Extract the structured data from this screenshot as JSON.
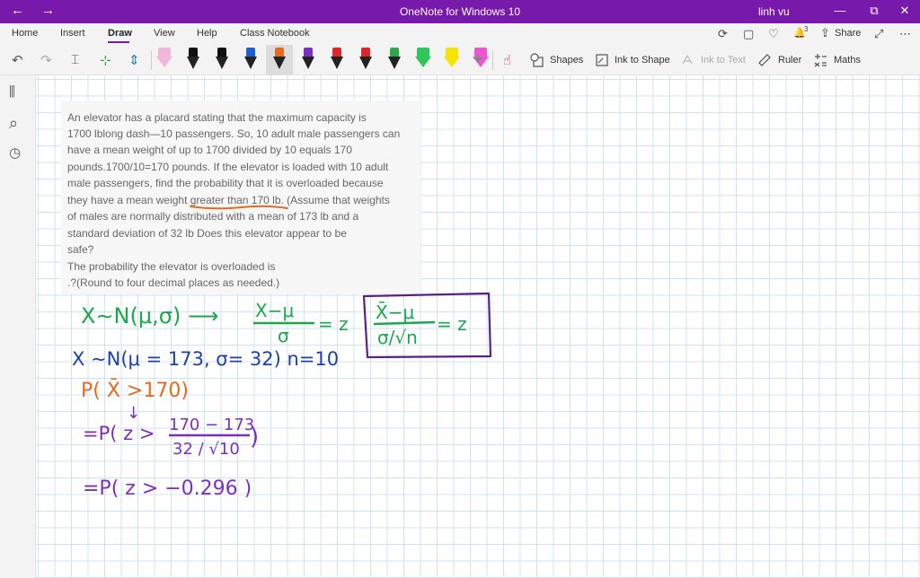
{
  "titlebar": {
    "back": "←",
    "forward": "→",
    "app_title": "OneNote for Windows 10",
    "user": "linh vu",
    "minimize": "—",
    "restore": "⧉",
    "close": "✕"
  },
  "tabs": [
    {
      "label": "Home"
    },
    {
      "label": "Insert"
    },
    {
      "label": "Draw",
      "active": true
    },
    {
      "label": "View"
    },
    {
      "label": "Help"
    },
    {
      "label": "Class Notebook"
    }
  ],
  "tab_actions": {
    "sync": "⟳",
    "notebook": "▢",
    "ideas": "♡",
    "notifications": "🔔",
    "notification_count": "3",
    "share_icon": "⇪",
    "share_label": "Share",
    "expand": "⤢",
    "more": "⋯"
  },
  "toolbar": {
    "undo": "↶",
    "redo": "↷",
    "select_icon": "⌶",
    "lasso_icon": "⊹",
    "space_icon": "⇕",
    "add_pen": "+",
    "replay_icon": "☝",
    "shapes_label": "Shapes",
    "ink_to_shape_label": "Ink to Shape",
    "ink_to_text_label": "Ink to Text",
    "ruler_label": "Ruler",
    "maths_label": "Maths"
  },
  "pens": [
    {
      "color": "#f2b7d8",
      "type": "highlighter"
    },
    {
      "color": "#111111",
      "type": "pen"
    },
    {
      "color": "#111111",
      "type": "pen"
    },
    {
      "color": "#1f5fd0",
      "type": "pen"
    },
    {
      "color": "#e46a1e",
      "type": "pen"
    },
    {
      "color": "#7b2fbf",
      "type": "pen",
      "selected": true
    },
    {
      "color": "#e0262b",
      "type": "pen"
    },
    {
      "color": "#e0262b",
      "type": "pen"
    },
    {
      "color": "#2ea84a",
      "type": "pen"
    },
    {
      "color": "#2fc65a",
      "type": "highlighter"
    },
    {
      "color": "#f5e400",
      "type": "highlighter"
    },
    {
      "color": "#ee55d2",
      "type": "highlighter"
    }
  ],
  "rail": {
    "notebooks": "⫼",
    "search": "⌕",
    "recent": "◷"
  },
  "question": {
    "lines": [
      "An elevator has a placard stating that the maximum capacity is",
      "1700 lblong dash—10 passengers. So, 10 adult male passengers can",
      "have a mean weight of up to 1700 divided by 10 equals 170",
      "pounds.1700/10=170 pounds. If the elevator is loaded with 10 adult",
      "male passengers, find the probability that it is overloaded because",
      "they have a mean weight greater than 170 lb. (Assume that weights",
      "of males are normally distributed with a mean of 173 lb and a",
      "standard deviation of 32 lb Does this elevator appear to be",
      "safe?",
      "The probability the elevator is overloaded is",
      ".?(Round to four decimal places as needed.)"
    ]
  },
  "ink": {
    "line1": "X∼N(μ,σ) ⟶",
    "frac1_num": "X−μ",
    "frac1_den": "σ",
    "eq1": "= z",
    "frac2_num": "X̄−μ",
    "frac2_den": "σ/√n",
    "eq2": "= z",
    "line2": "X ∼N(μ = 173,  σ= 32)   n=10",
    "line3": "P( X̄ >170)",
    "arrow": "↓",
    "line4_prefix": "=P( z >",
    "frac3_num": "170 − 173",
    "frac3_den": "32 / √10",
    "line4_suffix": ")",
    "line5": "=P( z > −0.296 )",
    "color_green": "#1aa84a",
    "color_blue": "#1f3fb0",
    "color_orange": "#e46a1e",
    "color_purple": "#7b2fbf",
    "color_box": "#5b1f86"
  }
}
